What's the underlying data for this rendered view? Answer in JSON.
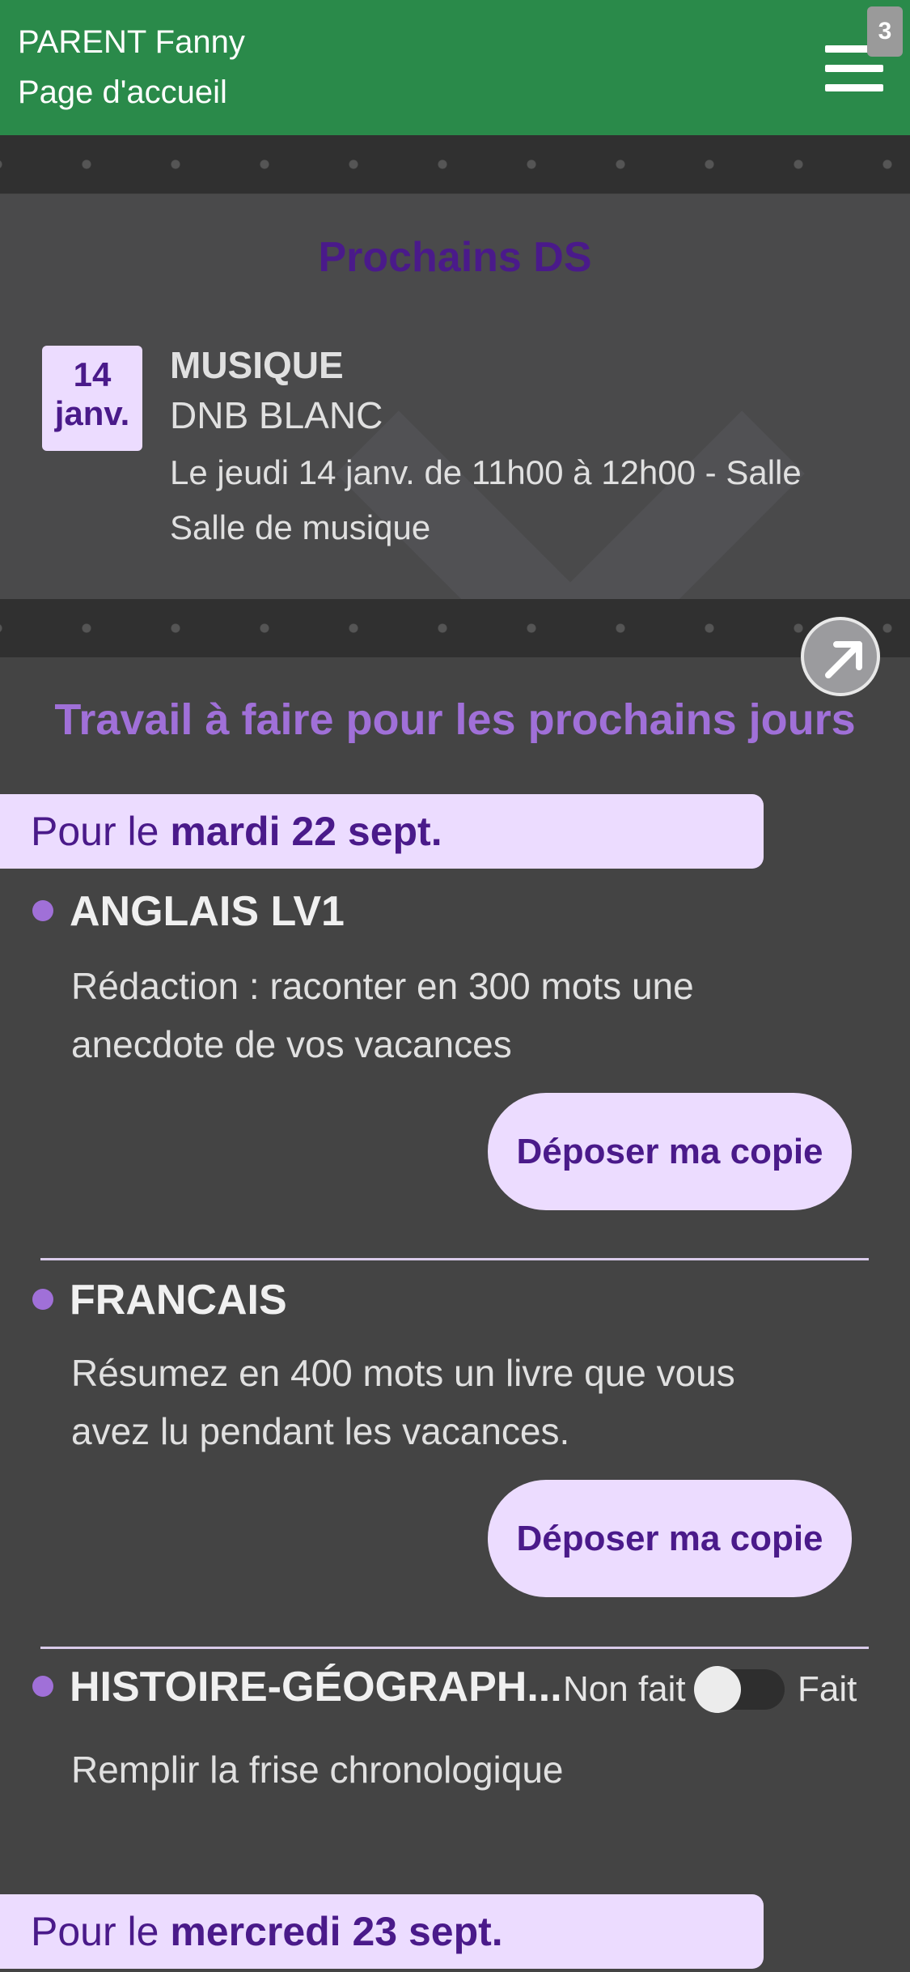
{
  "header": {
    "user_name": "PARENT Fanny",
    "page_title": "Page d'accueil",
    "notification_count": "3",
    "menu_icon": "hamburger-menu-icon"
  },
  "ds": {
    "title": "Prochains DS",
    "items": [
      {
        "day": "14",
        "month": "janv.",
        "subject": "MUSIQUE",
        "type": "DNB BLANC",
        "details": "Le jeudi 14 janv. de 11h00 à 12h00  - Salle Salle de musique"
      }
    ]
  },
  "travail": {
    "title": "Travail à faire pour les prochains jours",
    "open_icon": "arrow-up-right-icon",
    "days": [
      {
        "prefix": "Pour le ",
        "date": "mardi 22 sept.",
        "tasks": [
          {
            "subject": "ANGLAIS LV1",
            "description": "Rédaction : raconter en 300 mots une anecdote de vos vacances",
            "button": "Déposer ma copie"
          },
          {
            "subject": "FRANCAIS",
            "description": "Résumez en 400 mots un livre que vous avez lu pendant les vacances.",
            "button": "Déposer ma copie"
          },
          {
            "subject": "HISTOIRE-GÉOGRAPH...",
            "description": "Remplir la frise chronologique",
            "status_off": "Non fait",
            "status_on": "Fait",
            "done": false
          }
        ]
      },
      {
        "prefix": "Pour le ",
        "date": "mercredi 23 sept."
      }
    ]
  },
  "colors": {
    "header": "#2a8a4a",
    "accent_purple": "#a070d8",
    "dark_purple": "#4a1a8a",
    "light_purple": "#ecdcff",
    "background": "#444444"
  }
}
